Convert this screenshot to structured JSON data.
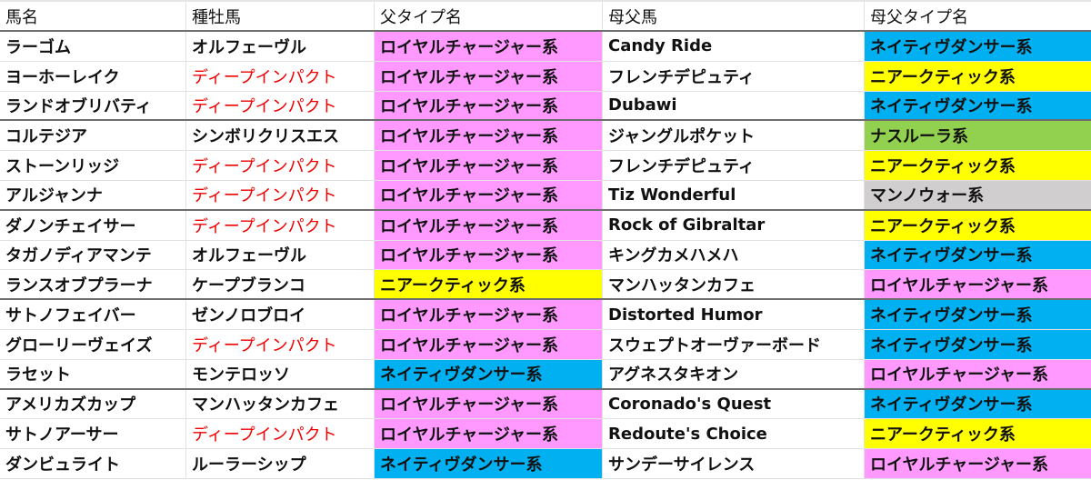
{
  "colors": {
    "ロイヤルチャージャー系": "#ff99ff",
    "ネイティヴダンサー系": "#00b0f0",
    "ニアークティック系": "#ffff00",
    "ナスルーラ系": "#92d050",
    "マンノウォー系": "#d0cece",
    "highlight_sire_text": "#f00000"
  },
  "headers": [
    "馬名",
    "種牡馬",
    "父タイプ名",
    "母父馬",
    "母父タイプ名"
  ],
  "rows": [
    {
      "horse": "ラーゴム",
      "sire": "オルフェーヴル",
      "sire_red": false,
      "sire_type": "ロイヤルチャージャー系",
      "dam_sire": "Candy Ride",
      "dam_sire_type": "ネイティヴダンサー系"
    },
    {
      "horse": "ヨーホーレイク",
      "sire": "ディープインパクト",
      "sire_red": true,
      "sire_type": "ロイヤルチャージャー系",
      "dam_sire": "フレンチデピュティ",
      "dam_sire_type": "ニアークティック系"
    },
    {
      "horse": "ランドオブリバティ",
      "sire": "ディープインパクト",
      "sire_red": true,
      "sire_type": "ロイヤルチャージャー系",
      "dam_sire": "Dubawi",
      "dam_sire_type": "ネイティヴダンサー系",
      "group_end": true
    },
    {
      "horse": "コルテジア",
      "sire": "シンボリクリスエス",
      "sire_red": false,
      "sire_type": "ロイヤルチャージャー系",
      "dam_sire": "ジャングルポケット",
      "dam_sire_type": "ナスルーラ系"
    },
    {
      "horse": "ストーンリッジ",
      "sire": "ディープインパクト",
      "sire_red": true,
      "sire_type": "ロイヤルチャージャー系",
      "dam_sire": "フレンチデピュティ",
      "dam_sire_type": "ニアークティック系"
    },
    {
      "horse": "アルジャンナ",
      "sire": "ディープインパクト",
      "sire_red": true,
      "sire_type": "ロイヤルチャージャー系",
      "dam_sire": "Tiz Wonderful",
      "dam_sire_type": "マンノウォー系",
      "group_end": true
    },
    {
      "horse": "ダノンチェイサー",
      "sire": "ディープインパクト",
      "sire_red": true,
      "sire_type": "ロイヤルチャージャー系",
      "dam_sire": "Rock of Gibraltar",
      "dam_sire_type": "ニアークティック系"
    },
    {
      "horse": "タガノディアマンテ",
      "sire": "オルフェーヴル",
      "sire_red": false,
      "sire_type": "ロイヤルチャージャー系",
      "dam_sire": "キングカメハメハ",
      "dam_sire_type": "ネイティヴダンサー系"
    },
    {
      "horse": "ランスオブプラーナ",
      "sire": "ケープブランコ",
      "sire_red": false,
      "sire_type": "ニアークティック系",
      "dam_sire": "マンハッタンカフェ",
      "dam_sire_type": "ロイヤルチャージャー系",
      "group_end": true
    },
    {
      "horse": "サトノフェイバー",
      "sire": "ゼンノロブロイ",
      "sire_red": false,
      "sire_type": "ロイヤルチャージャー系",
      "dam_sire": "Distorted Humor",
      "dam_sire_type": "ネイティヴダンサー系"
    },
    {
      "horse": "グローリーヴェイズ",
      "sire": "ディープインパクト",
      "sire_red": true,
      "sire_type": "ロイヤルチャージャー系",
      "dam_sire": "スウェプトオーヴァーボード",
      "dam_sire_type": "ネイティヴダンサー系"
    },
    {
      "horse": "ラセット",
      "sire": "モンテロッソ",
      "sire_red": false,
      "sire_type": "ネイティヴダンサー系",
      "dam_sire": "アグネスタキオン",
      "dam_sire_type": "ロイヤルチャージャー系",
      "group_end": true
    },
    {
      "horse": "アメリカズカップ",
      "sire": "マンハッタンカフェ",
      "sire_red": false,
      "sire_type": "ロイヤルチャージャー系",
      "dam_sire": "Coronado's Quest",
      "dam_sire_type": "ネイティヴダンサー系"
    },
    {
      "horse": "サトノアーサー",
      "sire": "ディープインパクト",
      "sire_red": true,
      "sire_type": "ロイヤルチャージャー系",
      "dam_sire": "Redoute's Choice",
      "dam_sire_type": "ニアークティック系"
    },
    {
      "horse": "ダンビュライト",
      "sire": "ルーラーシップ",
      "sire_red": false,
      "sire_type": "ネイティヴダンサー系",
      "dam_sire": "サンデーサイレンス",
      "dam_sire_type": "ロイヤルチャージャー系"
    }
  ]
}
